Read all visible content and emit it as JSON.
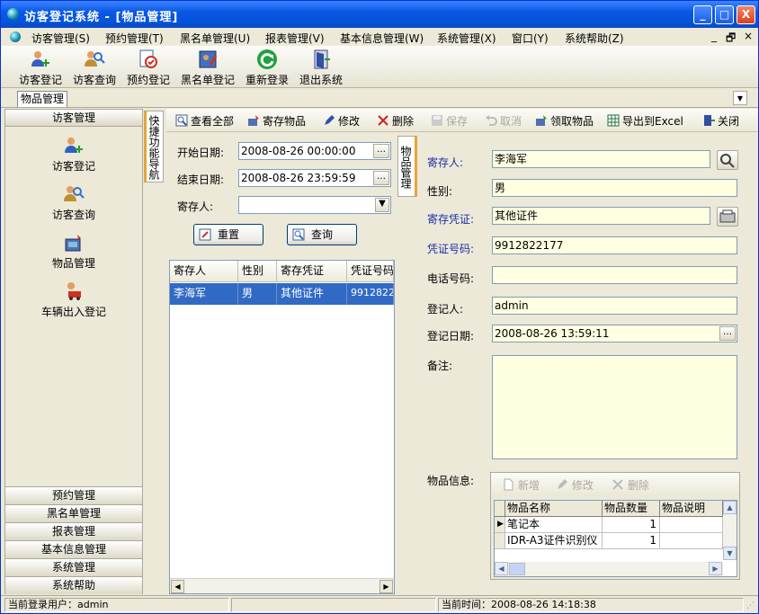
{
  "window": {
    "title": "访客登记系统 - [物品管理]",
    "btn_min": "_",
    "btn_max": "□",
    "btn_close": "X"
  },
  "menu": [
    {
      "label": "访客管理(S)"
    },
    {
      "label": "预约管理(T)"
    },
    {
      "label": "黑名单管理(U)"
    },
    {
      "label": "报表管理(V)"
    },
    {
      "label": "基本信息管理(W)"
    },
    {
      "label": "系统管理(X)"
    },
    {
      "label": "窗口(Y)"
    },
    {
      "label": "系统帮助(Z)"
    }
  ],
  "menu_right": {
    "min": "_",
    "restore": "🗗",
    "close": "×"
  },
  "toolbar": [
    {
      "label": "访客登记"
    },
    {
      "label": "访客查询"
    },
    {
      "label": "预约登记"
    },
    {
      "label": "黑名单登记"
    },
    {
      "label": "重新登录"
    },
    {
      "label": "退出系统"
    }
  ],
  "doc_tab": "物品管理",
  "nav": {
    "header": "访客管理",
    "items": [
      {
        "label": "访客登记"
      },
      {
        "label": "访客查询"
      },
      {
        "label": "物品管理"
      },
      {
        "label": "车辆出入登记"
      }
    ],
    "bottom": [
      {
        "label": "预约管理"
      },
      {
        "label": "黑名单管理"
      },
      {
        "label": "报表管理"
      },
      {
        "label": "基本信息管理"
      },
      {
        "label": "系统管理"
      },
      {
        "label": "系统帮助"
      }
    ]
  },
  "quick_nav": "快捷功能导航",
  "actions": [
    {
      "label": "查看全部",
      "enabled": true
    },
    {
      "label": "寄存物品",
      "enabled": true
    },
    {
      "label": "修改",
      "enabled": true
    },
    {
      "label": "删除",
      "enabled": true
    },
    {
      "label": "保存",
      "enabled": false
    },
    {
      "label": "取消",
      "enabled": false
    },
    {
      "label": "领取物品",
      "enabled": true
    },
    {
      "label": "导出到Excel",
      "enabled": true
    },
    {
      "label": "关闭",
      "enabled": true
    }
  ],
  "search": {
    "start_label": "开始日期:",
    "start_value": "2008-08-26 00:00:00",
    "end_label": "结束日期:",
    "end_value": "2008-08-26 23:59:59",
    "depositor_label": "寄存人:",
    "depositor_value": "",
    "reset_btn": "重置",
    "query_btn": "查询"
  },
  "grid": {
    "headers": [
      "寄存人",
      "性别",
      "寄存凭证",
      "凭证号码"
    ],
    "rows": [
      [
        "李海军",
        "男",
        "其他证件",
        "9912822177"
      ]
    ]
  },
  "vert_tab": "物品管理",
  "form": {
    "depositor_label": "寄存人:",
    "depositor": "李海军",
    "gender_label": "性别:",
    "gender": "男",
    "cert_label": "寄存凭证:",
    "cert": "其他证件",
    "cert_no_label": "凭证号码:",
    "cert_no": "9912822177",
    "phone_label": "电话号码:",
    "phone": "",
    "registrar_label": "登记人:",
    "registrar": "admin",
    "date_label": "登记日期:",
    "date": "2008-08-26 13:59:11",
    "remark_label": "备注:",
    "remark": "",
    "items_label": "物品信息:"
  },
  "items_toolbar": [
    {
      "label": "新增"
    },
    {
      "label": "修改"
    },
    {
      "label": "删除"
    }
  ],
  "items_grid": {
    "headers": [
      "物品名称",
      "物品数量",
      "物品说明"
    ],
    "rows": [
      [
        "笔记本",
        "1",
        ""
      ],
      [
        "IDR-A3证件识别仪",
        "1",
        ""
      ]
    ]
  },
  "status": {
    "user": "当前登录用户：admin",
    "time": "当前时间：2008-08-26 14:18:38"
  },
  "colors": {
    "accent": "#316ac5",
    "title_bar": "#0553d6",
    "tab_accent": "#e8a33b"
  }
}
